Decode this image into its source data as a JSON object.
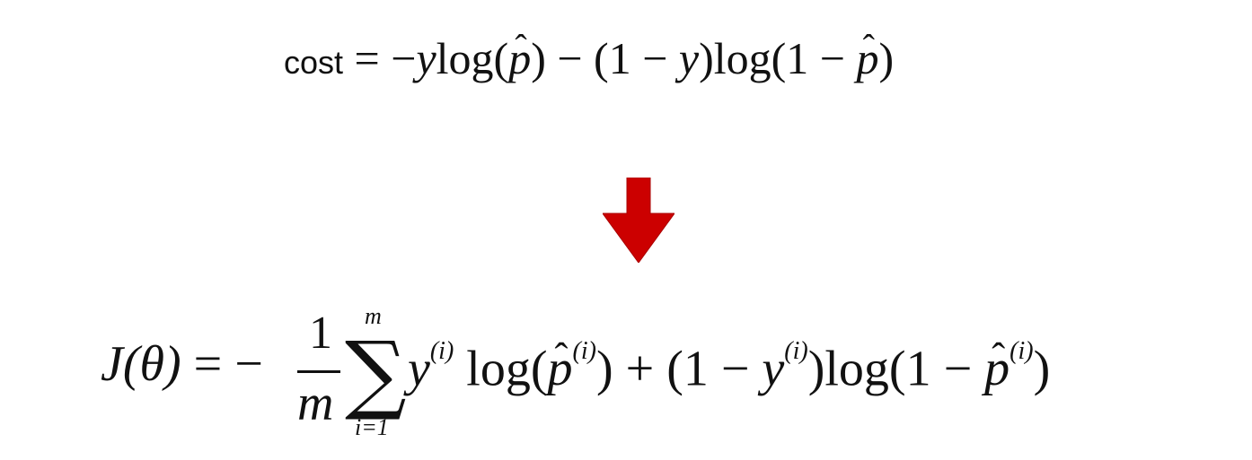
{
  "formulas": {
    "cost": {
      "label": "cost",
      "equals": " = −",
      "y1": "y",
      "log1": "log(",
      "phat1": "p",
      "close1": ")",
      "minus": " − (1 − ",
      "y2": "y",
      "close2": ")",
      "log2": "log(1 − ",
      "phat2": "p",
      "close3": ")"
    },
    "objective": {
      "J": "J",
      "theta": "(θ)",
      "equals": " = −",
      "numerator": "1",
      "denominator": "m",
      "sum_symbol": "∑",
      "sum_upper": "m",
      "sum_lower": "i=1",
      "y1": "y",
      "sup1": "(i)",
      "log1": " log(",
      "phat1": "p",
      "sup2": "(i)",
      "close1": ")",
      "plus": " + (1 − ",
      "y2": "y",
      "sup3": "(i)",
      "close2": ")",
      "log2": "log(1 − ",
      "phat2": "p",
      "sup4": "(i)",
      "close3": ")"
    }
  },
  "arrow": {
    "icon": "down-arrow-icon",
    "color": "#cc0000"
  }
}
